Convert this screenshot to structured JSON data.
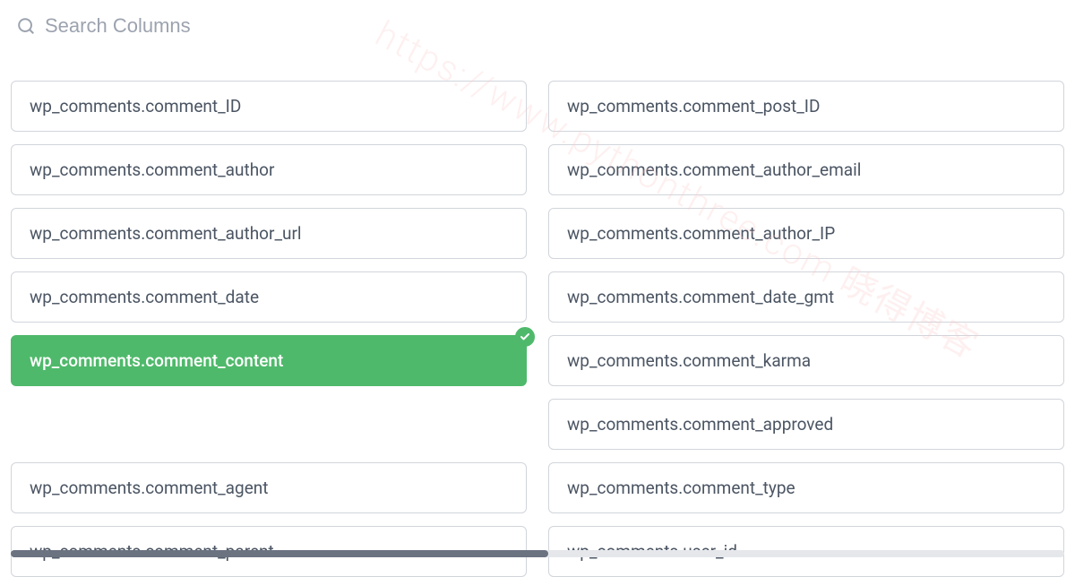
{
  "search": {
    "placeholder": "Search Columns",
    "value": ""
  },
  "watermark": "https://www.pythonthree.com 晓得博客",
  "columns": {
    "left": [
      {
        "label": "wp_comments.comment_ID",
        "selected": false
      },
      {
        "label": "wp_comments.comment_author",
        "selected": false
      },
      {
        "label": "wp_comments.comment_author_url",
        "selected": false
      },
      {
        "label": "wp_comments.comment_date",
        "selected": false
      },
      {
        "label": "wp_comments.comment_content",
        "selected": true
      },
      {
        "label": "",
        "empty": true
      },
      {
        "label": "wp_comments.comment_agent",
        "selected": false
      },
      {
        "label": "wp_comments.comment_parent",
        "selected": false
      }
    ],
    "right": [
      {
        "label": "wp_comments.comment_post_ID",
        "selected": false
      },
      {
        "label": "wp_comments.comment_author_email",
        "selected": false
      },
      {
        "label": "wp_comments.comment_author_IP",
        "selected": false
      },
      {
        "label": "wp_comments.comment_date_gmt",
        "selected": false
      },
      {
        "label": "wp_comments.comment_karma",
        "selected": false
      },
      {
        "label": "wp_comments.comment_approved",
        "selected": false
      },
      {
        "label": "wp_comments.comment_type",
        "selected": false
      },
      {
        "label": "wp_comments.user_id",
        "selected": false
      }
    ]
  },
  "colors": {
    "selected": "#4fb96b",
    "border": "#d1d5db",
    "text": "#4b5563",
    "placeholder": "#9ca3af"
  }
}
